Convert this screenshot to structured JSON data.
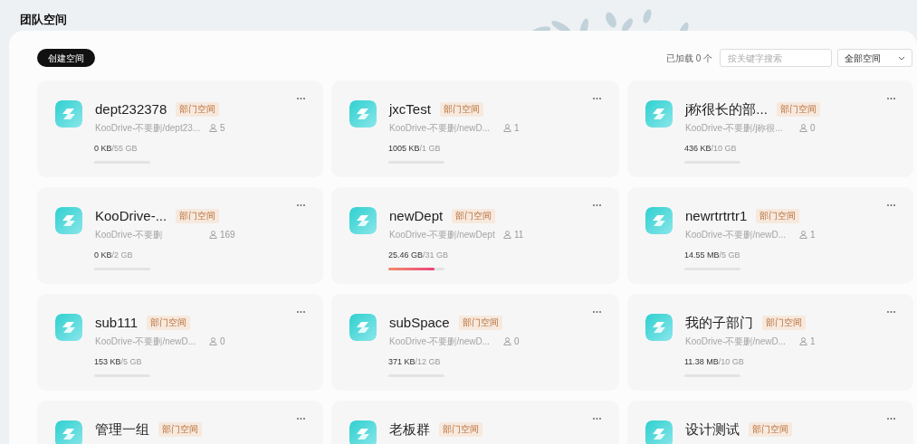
{
  "page_title": "团队空间",
  "toolbar": {
    "create_button": "创建空间",
    "loaded_count": "已加载 0 个",
    "search": {
      "placeholder": "按关键字搜索"
    },
    "filter": {
      "value": "全部空间"
    }
  },
  "spaces": [
    {
      "name": "dept232378",
      "badge": "部门空间",
      "path": "KooDrive-不要删/dept23...",
      "members": "5",
      "used": "0 KB",
      "total": "/55 GB",
      "level": 0
    },
    {
      "name": "jxcTest",
      "badge": "部门空间",
      "path": "KooDrive-不要删/newD...",
      "members": "1",
      "used": "1005 KB",
      "total": "/1 GB",
      "level": 0.001
    },
    {
      "name": "j称很长的部...",
      "badge": "部门空间",
      "path": "KooDrive-不要删/j称很...",
      "members": "0",
      "used": "436 KB",
      "total": "/10 GB",
      "level": 0
    },
    {
      "name": "KooDrive-...",
      "badge": "部门空间",
      "path": "KooDrive-不要删",
      "members": "169",
      "used": "0 KB",
      "total": "/2 GB",
      "level": 0
    },
    {
      "name": "newDept",
      "badge": "部门空间",
      "path": "KooDrive-不要删/newDept",
      "members": "11",
      "used": "25.46 GB",
      "total": "/31 GB",
      "level": 0.82
    },
    {
      "name": "newrtrtrtr1",
      "badge": "部门空间",
      "path": "KooDrive-不要删/newD...",
      "members": "1",
      "used": "14.55 MB",
      "total": "/5 GB",
      "level": 0.003
    },
    {
      "name": "sub111",
      "badge": "部门空间",
      "path": "KooDrive-不要删/newD...",
      "members": "0",
      "used": "153 KB",
      "total": "/5 GB",
      "level": 0
    },
    {
      "name": "subSpace",
      "badge": "部门空间",
      "path": "KooDrive-不要删/newD...",
      "members": "0",
      "used": "371 KB",
      "total": "/12 GB",
      "level": 0
    },
    {
      "name": "我的子部门",
      "badge": "部门空间",
      "path": "KooDrive-不要删/newD...",
      "members": "1",
      "used": "11.38 MB",
      "total": "/10 GB",
      "level": 0.001
    },
    {
      "name": "管理一组",
      "badge": "部门空间"
    },
    {
      "name": "老板群",
      "badge": "部门空间"
    },
    {
      "name": "设计测试",
      "badge": "部门空间"
    }
  ]
}
